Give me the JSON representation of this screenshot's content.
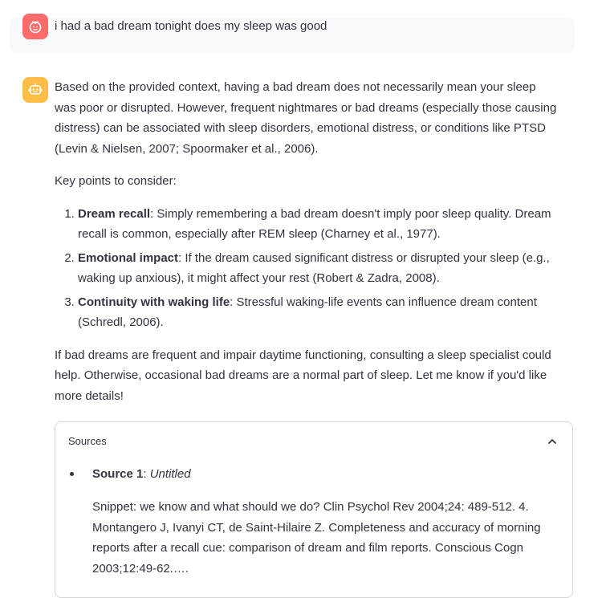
{
  "user_message": {
    "text": "i had a bad dream tonight does my sleep was good",
    "avatar_icon": "user-face-icon",
    "avatar_color": "#ff6b6b"
  },
  "assistant_message": {
    "avatar_icon": "robot-icon",
    "avatar_color": "#ffbd45",
    "intro": "Based on the provided context, having a bad dream does not necessarily mean your sleep was poor or disrupted. However, frequent nightmares or bad dreams (especially those causing distress) can be associated with sleep disorders, emotional distress, or conditions like PTSD (Levin & Nielsen, 2007; Spoormaker et al., 2006).",
    "key_points_heading": "Key points to consider:",
    "points": [
      {
        "title": "Dream recall",
        "text": ": Simply remembering a bad dream doesn't imply poor sleep quality. Dream recall is common, especially after REM sleep (Charney et al., 1977)."
      },
      {
        "title": "Emotional impact",
        "text": ": If the dream caused significant distress or disrupted your sleep (e.g., waking up anxious), it might affect your rest (Robert & Zadra, 2008)."
      },
      {
        "title": "Continuity with waking life",
        "text": ": Stressful waking-life events can influence dream content (Schredl, 2006)."
      }
    ],
    "conclusion": "If bad dreams are frequent and impair daytime functioning, consulting a sleep specialist could help. Otherwise, occasional bad dreams are a normal part of sleep. Let me know if you'd like more details!"
  },
  "sources": {
    "header": "Sources",
    "expanded": true,
    "items": [
      {
        "label": "Source 1",
        "separator": ": ",
        "title": "Untitled",
        "snippet": "Snippet: we know and what should we do? Clin Psychol Rev 2004;24: 489-512. 4. Montangero J, Ivanyi CT, de Saint-Hilaire Z. Completeness and accuracy of morning reports after a recall cue: comparison of dream and film reports. Conscious Cogn 2003;12:49-62.…."
      }
    ]
  }
}
